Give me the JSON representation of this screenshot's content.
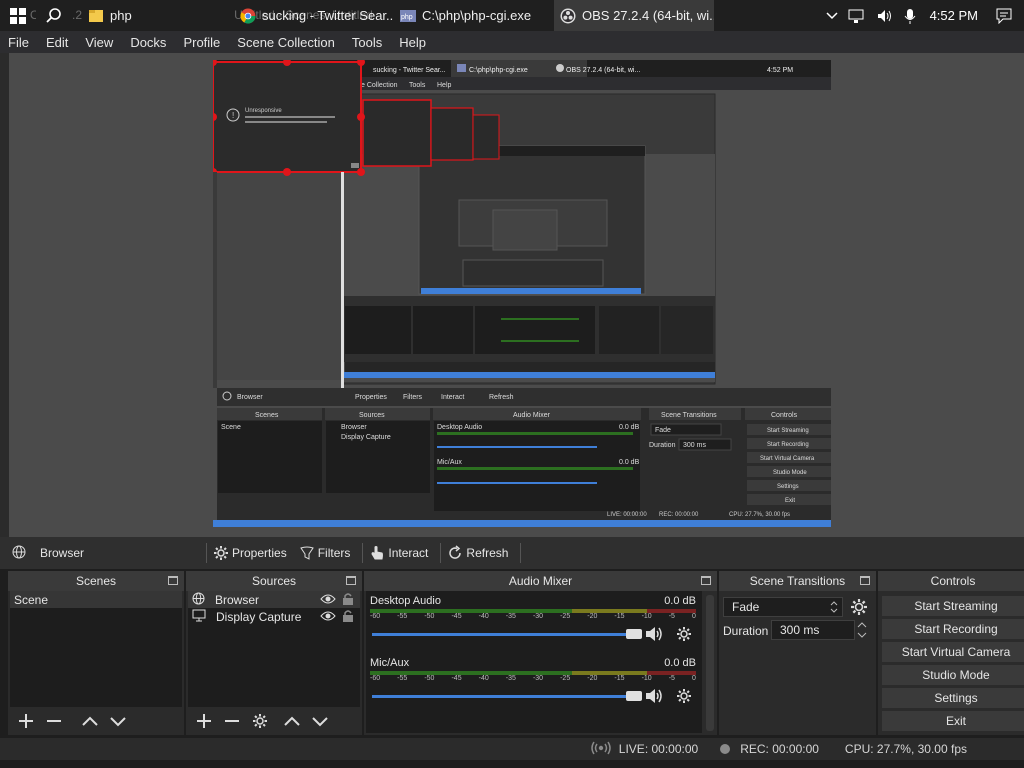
{
  "taskbar": {
    "ghost_text": "OBS 27.2.4 (64-bit windows) - Profile: Untitled - Scenes: Untitled",
    "tasks": [
      {
        "label": "php",
        "icon": "folder-icon",
        "color": "#f3c94b"
      },
      {
        "label": "sucking - Twitter Sear...",
        "icon": "chrome-icon"
      },
      {
        "label": "C:\\php\\php-cgi.exe",
        "icon": "php-icon"
      },
      {
        "label": "OBS 27.2.4 (64-bit, wi...",
        "icon": "obs-icon"
      }
    ],
    "clock": "4:52 PM"
  },
  "menu": [
    "File",
    "Edit",
    "View",
    "Docks",
    "Profile",
    "Scene Collection",
    "Tools",
    "Help"
  ],
  "source_toolbar": {
    "source_name": "Browser",
    "properties": "Properties",
    "filters": "Filters",
    "interact": "Interact",
    "refresh": "Refresh"
  },
  "docks": {
    "scenes": {
      "title": "Scenes",
      "items": [
        "Scene"
      ]
    },
    "sources": {
      "title": "Sources",
      "items": [
        "Browser",
        "Display Capture"
      ]
    },
    "mixer": {
      "title": "Audio Mixer",
      "channels": [
        {
          "name": "Desktop Audio",
          "db": "0.0 dB"
        },
        {
          "name": "Mic/Aux",
          "db": "0.0 dB"
        }
      ],
      "ticks": [
        "-60",
        "-55",
        "-50",
        "-45",
        "-40",
        "-35",
        "-30",
        "-25",
        "-20",
        "-15",
        "-10",
        "-5",
        "0"
      ]
    },
    "transitions": {
      "title": "Scene Transitions",
      "transition": "Fade",
      "duration_label": "Duration",
      "duration": "300 ms"
    },
    "controls": {
      "title": "Controls",
      "buttons": [
        "Start Streaming",
        "Start Recording",
        "Start Virtual Camera",
        "Studio Mode",
        "Settings",
        "Exit"
      ]
    }
  },
  "status": {
    "live": "LIVE: 00:00:00",
    "rec": "REC: 00:00:00",
    "cpu": "CPU: 27.7%, 30.00 fps"
  },
  "nested_preview": {
    "tabs": [
      "sucking - Twitter Sear...",
      "C:\\php\\php-cgi.exe",
      "OBS 27.2.4 (64-bit, wi..."
    ],
    "clock": "4:52 PM",
    "menu": [
      "e Collection",
      "Tools",
      "Help"
    ],
    "popup_title": "Unresponsive",
    "source_name": "Browser",
    "buttons": [
      "Properties",
      "Filters",
      "Interact",
      "Refresh"
    ],
    "dock_titles": [
      "Scenes",
      "Sources",
      "Audio Mixer",
      "Scene Transitions",
      "Controls"
    ],
    "scene": "Scene",
    "sources": [
      "Browser",
      "Display Capture"
    ],
    "channels": [
      "Desktop Audio",
      "Mic/Aux"
    ],
    "db": "0.0 dB",
    "transition": "Fade",
    "duration_label": "Duration",
    "duration": "300 ms",
    "controls": [
      "Start Streaming",
      "Start Recording",
      "Start Virtual Camera",
      "Studio Mode",
      "Settings",
      "Exit"
    ],
    "status": [
      "LIVE: 00:00:00",
      "REC: 00:00:00",
      "CPU: 27.7%, 30.00 fps"
    ]
  },
  "colors": {
    "accent": "#3f7fd8",
    "selection_red": "#e0151a",
    "panel": "#2b2b2b",
    "preview_bg": "#4b4b4b"
  }
}
